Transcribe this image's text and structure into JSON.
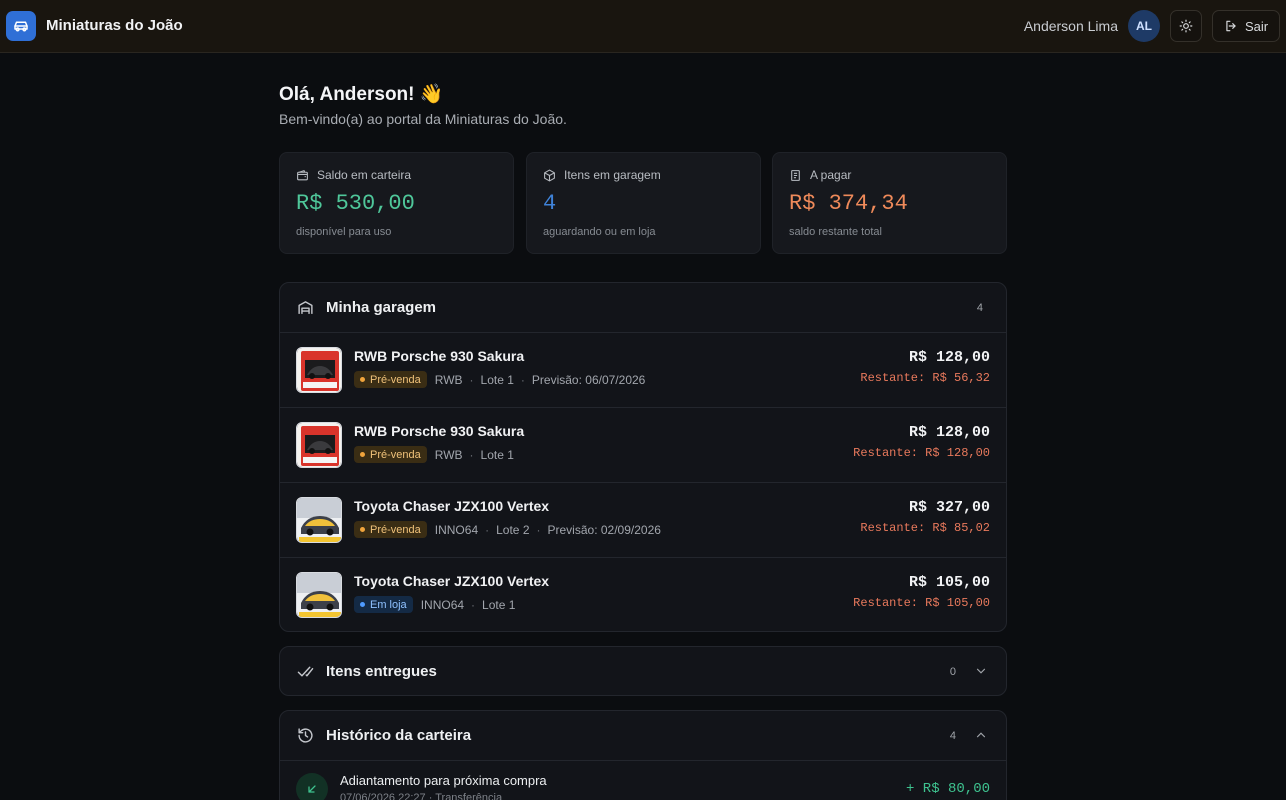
{
  "header": {
    "brand": "Miniaturas do João",
    "user_name": "Anderson Lima",
    "avatar_initials": "AL",
    "logout_label": "Sair"
  },
  "greeting": {
    "title": "Olá, Anderson! 👋",
    "subtitle": "Bem-vindo(a) ao portal da Miniaturas do João."
  },
  "stats": [
    {
      "label": "Saldo em carteira",
      "value": "R$ 530,00",
      "note": "disponível para uso",
      "color": "#4fc79a",
      "icon": "wallet-icon"
    },
    {
      "label": "Itens em garagem",
      "value": "4",
      "note": "aguardando ou em loja",
      "color": "#3f82d8",
      "icon": "package-icon"
    },
    {
      "label": "A pagar",
      "value": "R$ 374,34",
      "note": "saldo restante total",
      "color": "#ef8a5a",
      "icon": "receipt-icon"
    }
  ],
  "garage": {
    "title": "Minha garagem",
    "count": "4",
    "items": [
      {
        "name": "RWB Porsche 930 Sakura",
        "status": "Pré-venda",
        "brand": "RWB",
        "lot": "Lote 1",
        "forecast": "Previsão: 06/07/2026",
        "price": "R$ 128,00",
        "remaining": "Restante: R$ 56,32"
      },
      {
        "name": "RWB Porsche 930 Sakura",
        "status": "Pré-venda",
        "brand": "RWB",
        "lot": "Lote 1",
        "forecast": "",
        "price": "R$ 128,00",
        "remaining": "Restante: R$ 128,00"
      },
      {
        "name": "Toyota Chaser JZX100 Vertex",
        "status": "Pré-venda",
        "brand": "INNO64",
        "lot": "Lote 2",
        "forecast": "Previsão: 02/09/2026",
        "price": "R$ 327,00",
        "remaining": "Restante: R$ 85,02"
      },
      {
        "name": "Toyota Chaser JZX100 Vertex",
        "status": "Em loja",
        "brand": "INNO64",
        "lot": "Lote 1",
        "forecast": "",
        "price": "R$ 105,00",
        "remaining": "Restante: R$ 105,00"
      }
    ]
  },
  "delivered": {
    "title": "Itens entregues",
    "count": "0"
  },
  "history": {
    "title": "Histórico da carteira",
    "count": "4",
    "entries": [
      {
        "title": "Adiantamento para próxima compra",
        "meta": "07/06/2026 22:27 · Transferência",
        "amount": "+ R$ 80,00"
      }
    ]
  }
}
